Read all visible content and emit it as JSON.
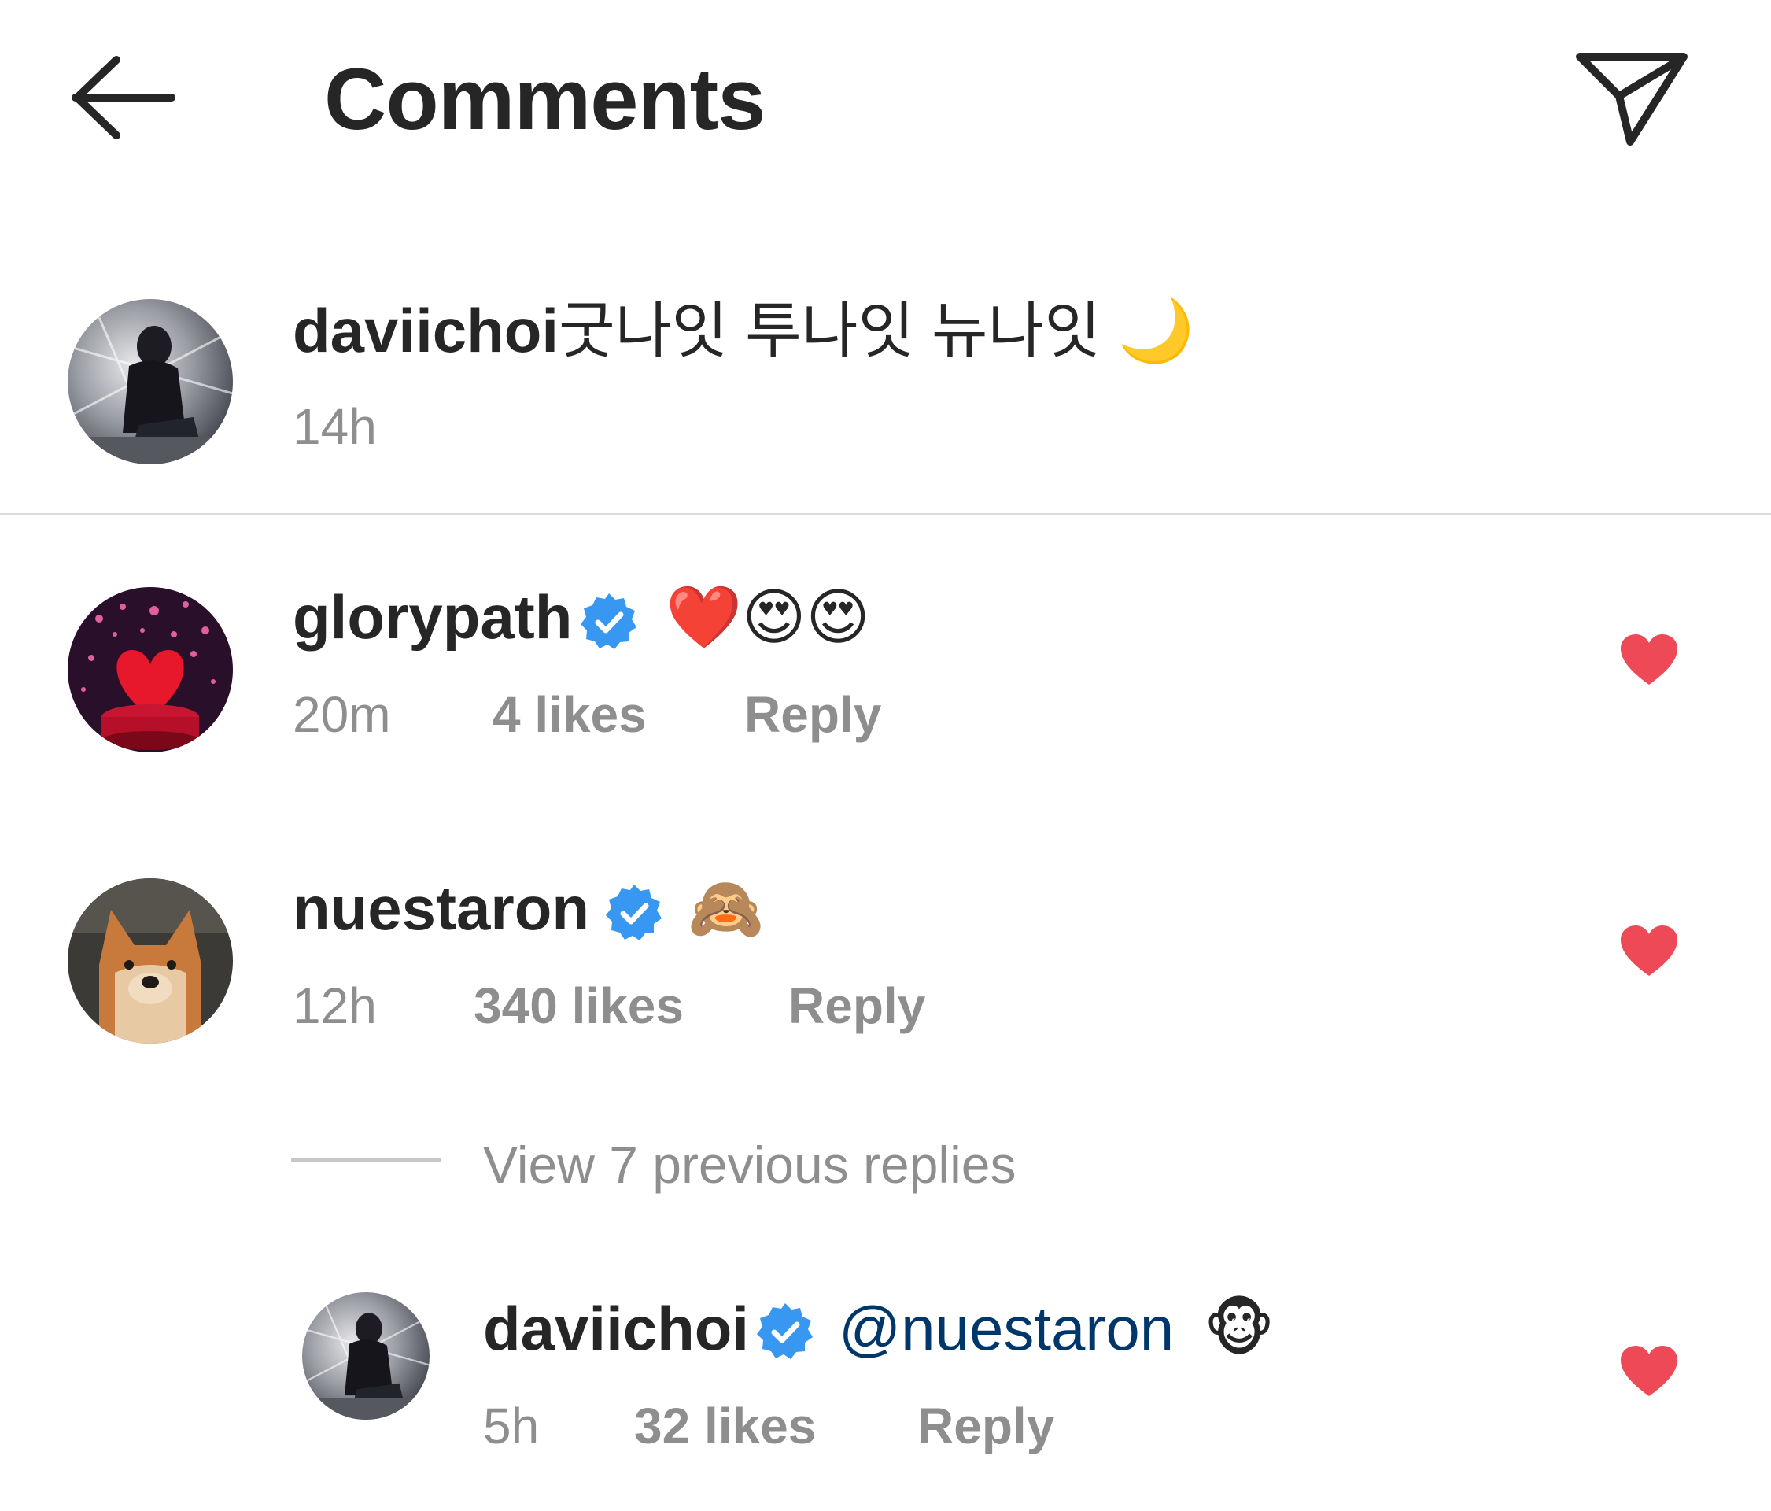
{
  "header": {
    "title": "Comments",
    "back_icon": "arrow-left-icon",
    "share_icon": "paper-plane-icon"
  },
  "caption": {
    "username": "daviichoi",
    "text": "굿나잇 투나잇 뉴나잇 🌙",
    "time": "14h"
  },
  "comments": [
    {
      "username": "glorypath",
      "verified": true,
      "text": "❤️😍😍",
      "time": "20m",
      "likes": "4 likes",
      "reply_label": "Reply",
      "liked": true
    },
    {
      "username": "nuestaron",
      "verified": true,
      "text": "🙈",
      "time": "12h",
      "likes": "340 likes",
      "reply_label": "Reply",
      "liked": true
    }
  ],
  "view_replies": "View 7 previous replies",
  "reply": {
    "username": "daviichoi",
    "verified": true,
    "mention": "@nuestaron",
    "emoji": "🐵",
    "time": "5h",
    "likes": "32 likes",
    "reply_label": "Reply",
    "liked": true
  },
  "colors": {
    "heart": "#ed4956",
    "verified": "#3897f0",
    "mention": "#00376b",
    "meta": "#8e8e8e"
  }
}
